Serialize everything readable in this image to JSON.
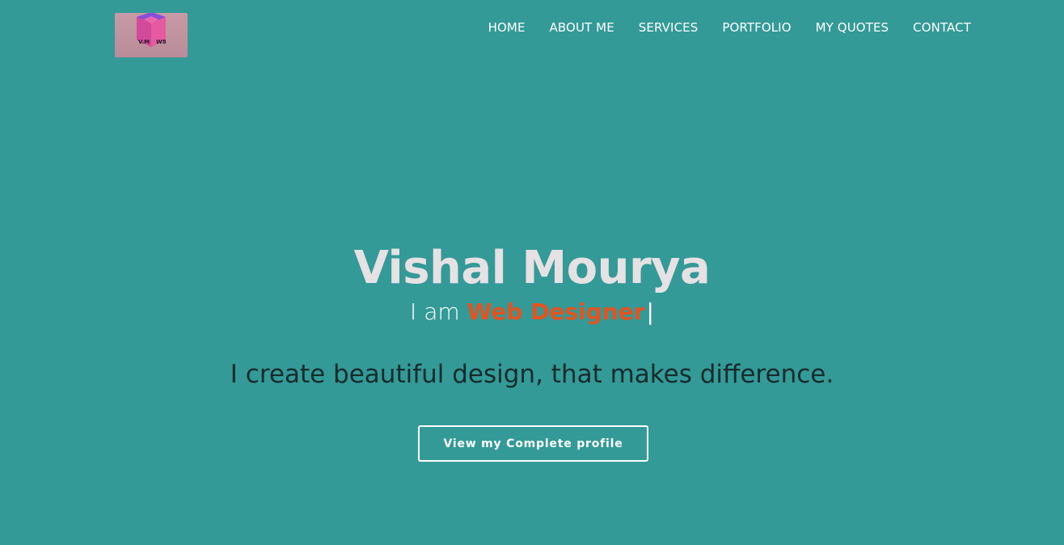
{
  "logo": {
    "text_left": "V.M",
    "text_right": "W8",
    "icon": "cube-logo-icon"
  },
  "nav": {
    "items": [
      {
        "label": "HOME"
      },
      {
        "label": "ABOUT ME"
      },
      {
        "label": "SERVICES"
      },
      {
        "label": "PORTFOLIO"
      },
      {
        "label": "MY QUOTES"
      },
      {
        "label": "CONTACT"
      }
    ]
  },
  "hero": {
    "name": "Vishal Mourya",
    "role_prefix": "I am",
    "role_value": "Web Designer",
    "cursor": "|",
    "tagline": "I create beautiful design, that makes difference.",
    "cta_label": "View my Complete profile"
  },
  "colors": {
    "background": "#339a98",
    "accent": "#e7521d",
    "name_text": "#e6e1e3",
    "tagline_text": "#152b2b"
  }
}
